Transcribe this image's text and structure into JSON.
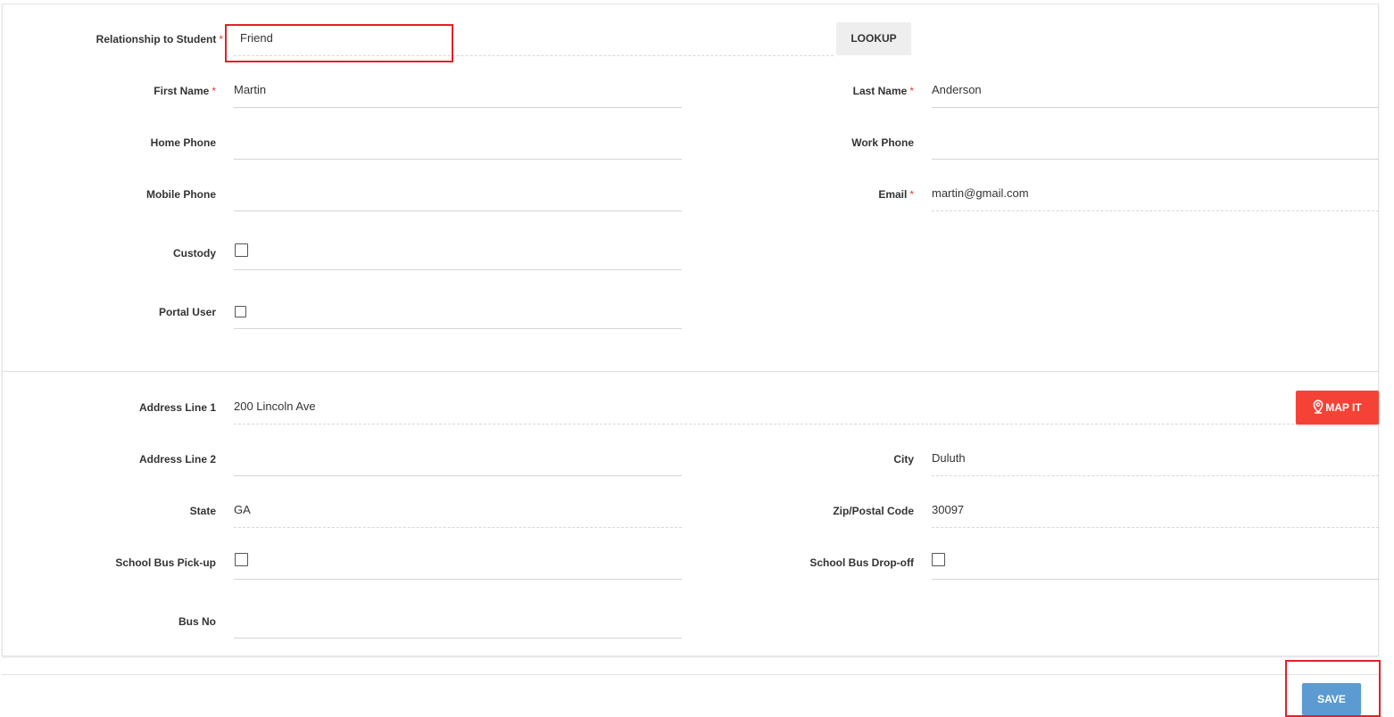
{
  "contact": {
    "relationship": {
      "label": "Relationship to Student",
      "value": "Friend",
      "required": "*"
    },
    "lookup_label": "LOOKUP",
    "first_name": {
      "label": "First Name",
      "value": "Martin",
      "required": "*"
    },
    "last_name": {
      "label": "Last Name",
      "value": "Anderson",
      "required": "*"
    },
    "home_phone": {
      "label": "Home Phone",
      "value": ""
    },
    "work_phone": {
      "label": "Work Phone",
      "value": ""
    },
    "mobile_phone": {
      "label": "Mobile Phone",
      "value": ""
    },
    "email": {
      "label": "Email",
      "value": "martin@gmail.com",
      "required": "*"
    },
    "custody": {
      "label": "Custody",
      "checked": false
    },
    "portal_user": {
      "label": "Portal User",
      "checked": false
    }
  },
  "address": {
    "line1": {
      "label": "Address Line 1",
      "value": "200 Lincoln Ave"
    },
    "map_it_label": "MAP IT",
    "line2": {
      "label": "Address Line 2",
      "value": ""
    },
    "city": {
      "label": "City",
      "value": "Duluth"
    },
    "state": {
      "label": "State",
      "value": "GA"
    },
    "zip": {
      "label": "Zip/Postal Code",
      "value": "30097"
    },
    "bus_pickup": {
      "label": "School Bus Pick-up",
      "checked": false
    },
    "bus_dropoff": {
      "label": "School Bus Drop-off",
      "checked": false
    },
    "bus_no": {
      "label": "Bus No",
      "value": ""
    }
  },
  "footer": {
    "save_label": "SAVE"
  },
  "colors": {
    "required": "#e53935",
    "map_it": "#f44336",
    "save": "#5b9bd1",
    "highlight": "#e32028"
  },
  "icons": {
    "map_it": "map-pin-icon"
  }
}
